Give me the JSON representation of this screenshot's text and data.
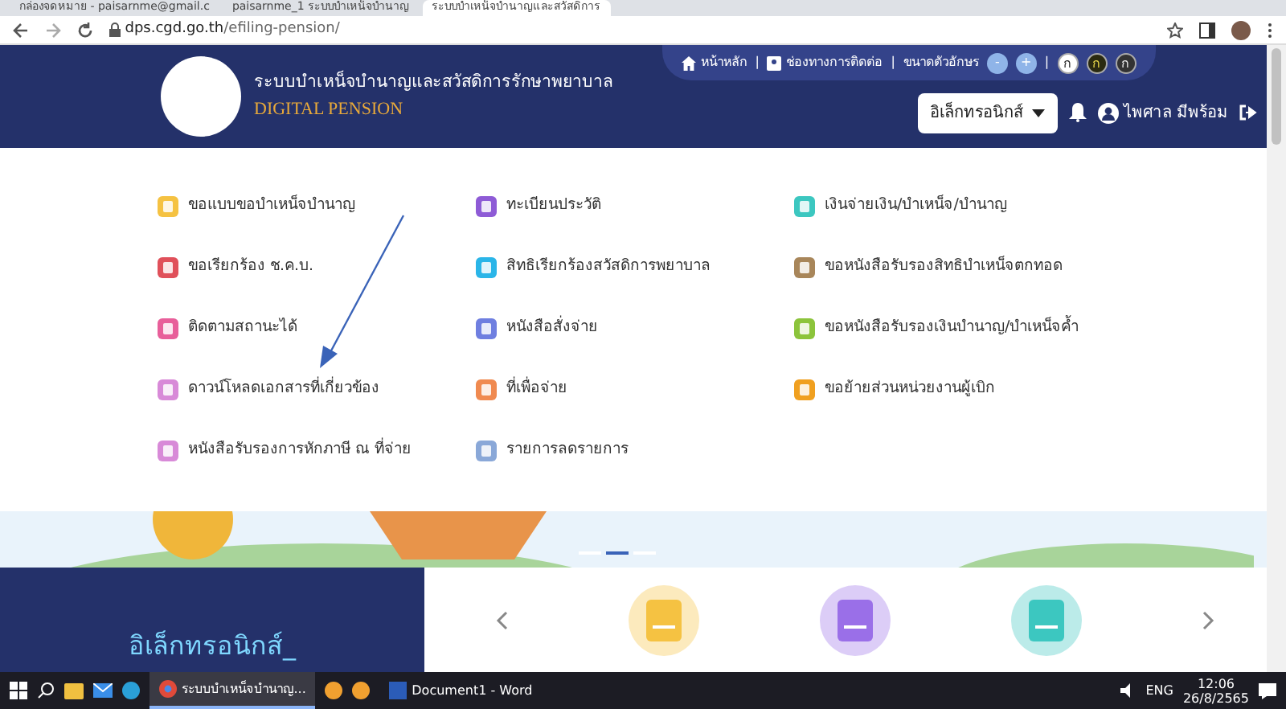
{
  "browser": {
    "tabs": [
      {
        "title": "กล่องจดหมาย - paisarnme@gmail.c",
        "selected": false
      },
      {
        "title": "paisarnme_1 ระบบบำเหน็จบำนาญ",
        "selected": false
      },
      {
        "title": "ระบบบำเหน็จบำนาญและสวัสดิการ",
        "selected": true
      }
    ],
    "url_host": "dps.cgd.go.th",
    "url_path": "/efiling-pension/"
  },
  "header": {
    "title": "ระบบบำเหน็จบำนาญและสวัสดิการรักษาพยาบาล",
    "subtitle": "DIGITAL PENSION",
    "links": [
      "หน้าหลัก",
      "ช่องทางการติดต่อ"
    ],
    "separator": "|",
    "font_size_label": "ขนาดตัวอักษร",
    "font_buttons": [
      "-",
      "+"
    ],
    "contrast_buttons": [
      "ก",
      "ก",
      "ก"
    ],
    "dropdown": "อิเล็กทรอนิกส์",
    "user": "ไพศาล มีพร้อม"
  },
  "menu": [
    {
      "label": "ขอแบบขอบำเหน็จบำนาญ",
      "color": "#f5c242"
    },
    {
      "label": "ทะเบียนประวัติ",
      "color": "#8e5bd6"
    },
    {
      "label": "เงินจ่ายเงิน/บำเหน็จ/บำนาญ",
      "color": "#3cc7c0"
    },
    {
      "label": "ขอเรียกร้อง ช.ค.บ.",
      "color": "#e0505a"
    },
    {
      "label": "สิทธิเรียกร้องสวัสดิการพยาบาล",
      "color": "#2ab5e8"
    },
    {
      "label": "ขอหนังสือรับรองสิทธิบำเหน็จตกทอด",
      "color": "#a8865a"
    },
    {
      "label": "ติดตามสถานะได้",
      "color": "#e85f9a"
    },
    {
      "label": "หนังสือสั่งจ่าย",
      "color": "#6f7fe0"
    },
    {
      "label": "ขอหนังสือรับรองเงินบำนาญ/บำเหน็จค้ำ",
      "color": "#8cc43c"
    },
    {
      "label": "ดาวน์โหลดเอกสารที่เกี่ยวข้อง",
      "color": "#d88ad8"
    },
    {
      "label": "ที่เพื่อจ่าย",
      "color": "#f08a50"
    },
    {
      "label": "ขอย้ายส่วนหน่วยงานผู้เบิก",
      "color": "#f0a020"
    },
    {
      "label": "หนังสือรับรองการหักภาษี ณ ที่จ่าย",
      "color": "#d88ad8"
    },
    {
      "label": "รายการลดรายการ",
      "color": "#8aa8d8"
    }
  ],
  "carousel": {
    "indicators": [
      {
        "selected": false
      },
      {
        "selected": true
      },
      {
        "selected": false
      }
    ]
  },
  "section_title": "อิเล็กทรอนิกส์_",
  "service_cards": [
    {
      "color": "#f5c242"
    },
    {
      "color": "#9a6fe8"
    },
    {
      "color": "#3cc7c0"
    }
  ],
  "taskbar": {
    "apps": [
      {
        "title": "ระบบบำเหน็จบำนาญ...",
        "selected": true
      },
      {
        "title": "Document1 - Word",
        "selected": false
      }
    ],
    "language": "ENG",
    "time": "12:06",
    "date": "26/8/2565"
  }
}
